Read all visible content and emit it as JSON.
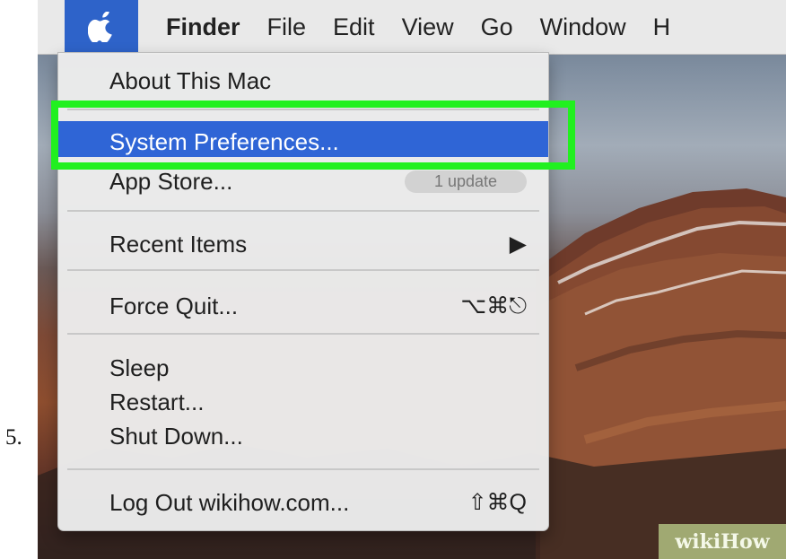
{
  "step": {
    "number": "5."
  },
  "menubar": {
    "apple_icon": "apple-logo-icon",
    "items": [
      "Finder",
      "File",
      "Edit",
      "View",
      "Go",
      "Window",
      "H"
    ]
  },
  "apple_menu": {
    "items": [
      {
        "label": "About This Mac"
      },
      {
        "label": "System Preferences..."
      },
      {
        "label": "App Store...",
        "badge": "1 update"
      },
      {
        "label": "Recent Items",
        "shortcut": "▶"
      },
      {
        "label": "Force Quit...",
        "shortcut": "⌥⌘⎋"
      },
      {
        "label": "Sleep"
      },
      {
        "label": "Restart..."
      },
      {
        "label": "Shut Down..."
      },
      {
        "label": "Log Out wikihow.com...",
        "shortcut": "⇧⌘Q"
      }
    ]
  },
  "watermark": {
    "text": "wikiHow"
  },
  "colors": {
    "selection": "#2f65d6",
    "highlight": "#21f01f",
    "menu_background": "#ececec"
  }
}
